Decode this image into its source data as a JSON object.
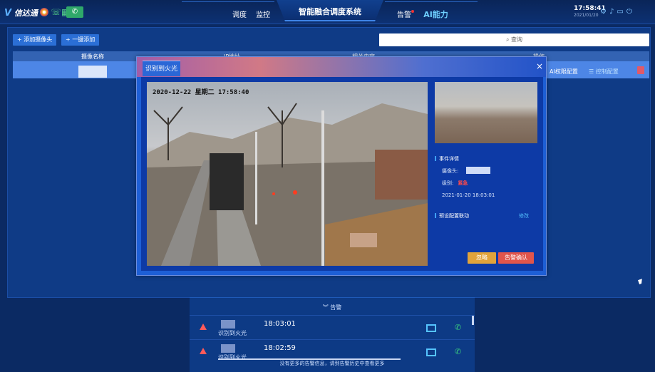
{
  "header": {
    "logo_text": "信达通",
    "nav_left": [
      "调度",
      "监控"
    ],
    "title": "智能融合调度系统",
    "nav_right": {
      "alarm": "告警",
      "ai": "AI能力"
    },
    "time": "17:58:41",
    "date": "2021/01/20"
  },
  "toolbar": {
    "add_camera": "+ 添加摄像头",
    "one_click_add": "+ 一键添加",
    "search_placeholder": "查询"
  },
  "table": {
    "headers": [
      "摄像名称",
      "IP地址",
      "相关内容",
      "操作"
    ],
    "row_actions": {
      "ai_config": "AI权限配置",
      "ctrl_config": "控制配置"
    }
  },
  "modal": {
    "title": "识别到火光",
    "video_osd": "2020-12-22 星期二 17:58:40",
    "event_details_title": "事件详情",
    "camera_label": "摄像头:",
    "level_label": "级别:",
    "level_value": "紧急",
    "event_time": "2021-01-20 18:03:01",
    "linked_plan_title": "预设配置联动",
    "edit_label": "修改",
    "ignore_button": "忽略",
    "confirm_button": "告警确认"
  },
  "alarms": {
    "header": "告警",
    "items": [
      {
        "type": "识别到火光",
        "time": "18:03:01"
      },
      {
        "type": "识别到火光",
        "time": "18:02:59"
      }
    ],
    "footer": "没有更多的告警信息，请到告警历史中查看更多"
  },
  "colors": {
    "background": "#0b2a63",
    "accent": "#2b6fd6",
    "danger": "#e0554c",
    "warning": "#e0a33b"
  }
}
